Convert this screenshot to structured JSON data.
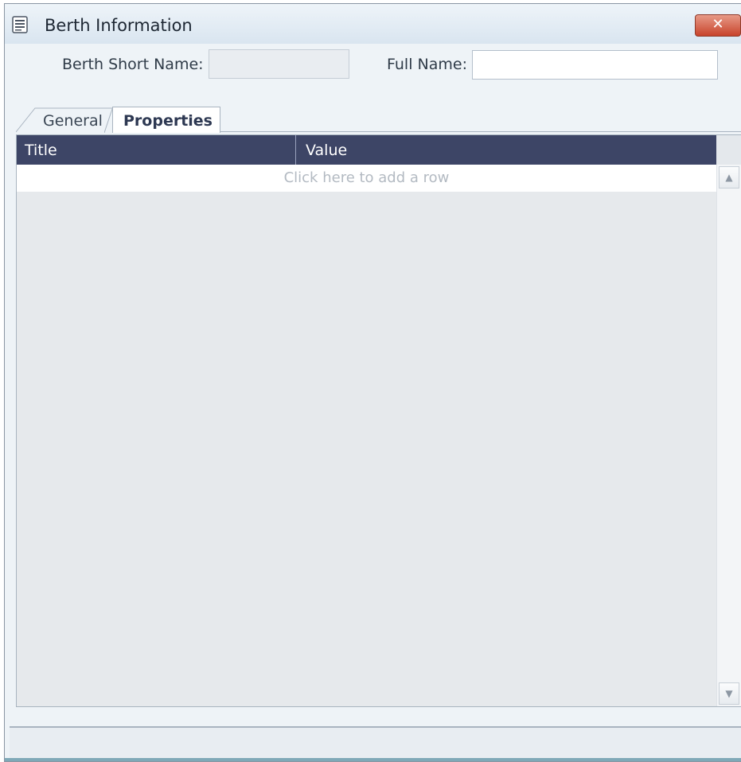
{
  "window": {
    "title": "Berth Information",
    "close_label": "✕"
  },
  "form": {
    "short_name_label": "Berth Short Name:",
    "short_name_value": "",
    "full_name_label": "Full Name:",
    "full_name_value": ""
  },
  "tabs": [
    {
      "label": "General",
      "active": false
    },
    {
      "label": "Properties",
      "active": true
    }
  ],
  "grid": {
    "columns": [
      "Title",
      "Value"
    ],
    "add_row_text": "Click here to add a row",
    "rows": []
  },
  "colors": {
    "header_bg": "#3d4566",
    "close_button": "#c8432b",
    "window_bg": "#eef3f7"
  },
  "icons": {
    "app": "document-stack-icon",
    "close": "close-icon",
    "scroll_up": "arrow-up-icon",
    "scroll_down": "arrow-down-icon"
  }
}
